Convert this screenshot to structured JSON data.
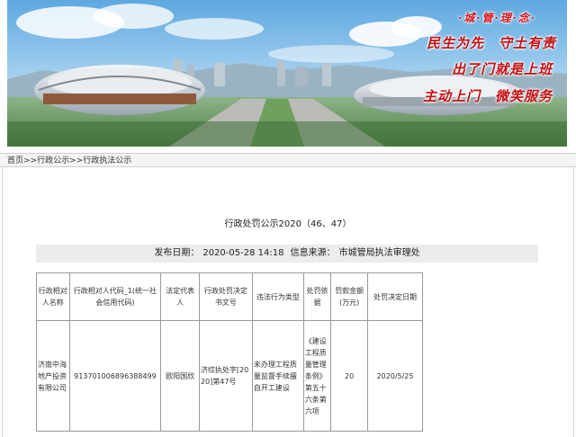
{
  "banner": {
    "slogan_title": "·城·管·理·念·",
    "slogans": [
      "民生为先　守土有责",
      "出了门就是上班",
      "主动上门　微笑服务"
    ],
    "colors": {
      "sky": "#8fc1e6",
      "slogan": "#c40f12"
    }
  },
  "breadcrumb": {
    "items": [
      "首页",
      "行政公示",
      "行政执法公示"
    ],
    "separator": ">>"
  },
  "document": {
    "title": "行政处罚公示2020（46、47）",
    "publish_label": "发布日期：",
    "publish_date": "2020-05-28 14:18",
    "source_label": "信息来源：",
    "source": "市城管局执法审理处"
  },
  "table": {
    "headers": [
      "行政相对人名称",
      "行政相对人代码_1(统一社会信用代码)",
      "法定代表人",
      "行政处罚决定书文号",
      "违法行为类型",
      "处罚依据",
      "罚款金额(万元)",
      "处罚决定日期"
    ],
    "rows": [
      [
        "济南中海地产投资有限公司",
        "91370100689638849​9",
        "欧阳国欣",
        "济综执处字[2020]第47号",
        "未办理工程质量监督手续擅自开工建设",
        "《建设工程质量管理条例》第五十六条第六项",
        "20",
        "2020/5/25"
      ]
    ]
  }
}
